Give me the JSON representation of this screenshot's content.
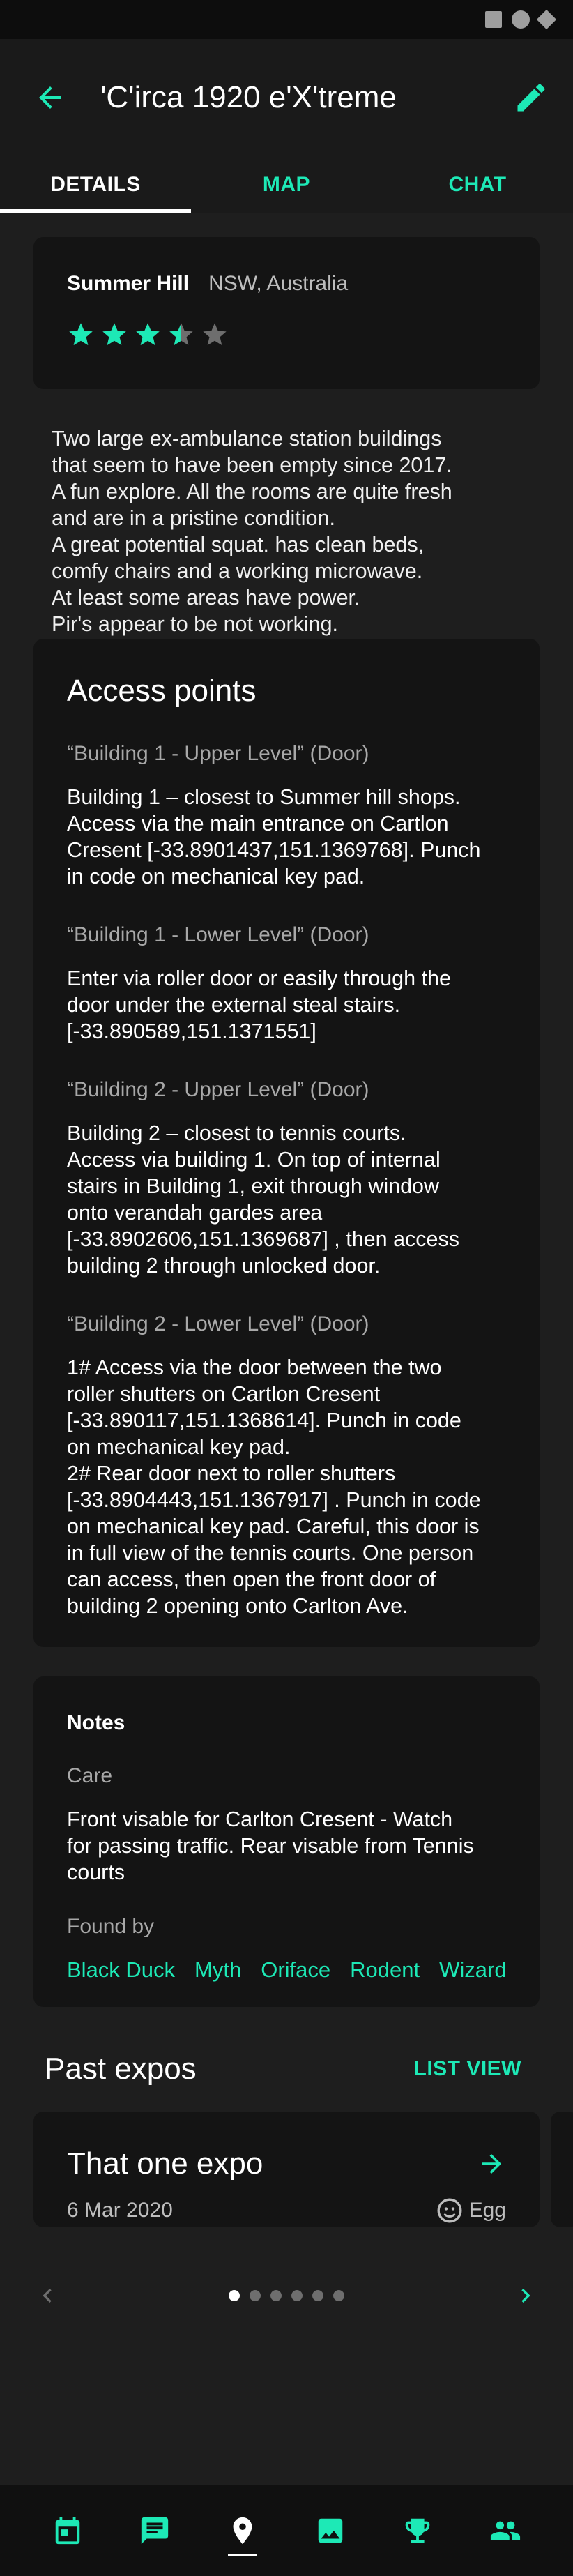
{
  "app": {
    "title": "'C'irca 1920 e'X'treme"
  },
  "tabs": [
    {
      "label": "DETAILS",
      "active": true
    },
    {
      "label": "MAP",
      "active": false
    },
    {
      "label": "CHAT",
      "active": false
    }
  ],
  "location": {
    "name": "Summer Hill",
    "region": "NSW, Australia",
    "rating": 3.5,
    "rating_max": 5
  },
  "description": "Two large ex-ambulance station buildings\nthat seem to have been empty since 2017.\nA fun explore. All the rooms are quite fresh\nand are in a pristine condition.\nA great potential squat. has clean beds,\ncomfy chairs and a working microwave.\nAt least some areas have power.\nPir's appear to be not working.",
  "access": {
    "title": "Access points",
    "points": [
      {
        "name": "“Building 1 - Upper Level” (Door)",
        "description": "Building 1 – closest to Summer hill shops.\nAccess via the main entrance on Cartlon\nCresent [-33.8901437,151.1369768]. Punch\nin code on mechanical key pad."
      },
      {
        "name": "“Building 1 - Lower Level” (Door)",
        "description": "Enter via roller door or easily through the\ndoor under the external steal stairs.\n[-33.890589,151.1371551]"
      },
      {
        "name": "“Building 2 - Upper Level” (Door)",
        "description": "Building 2 – closest to tennis courts.\nAccess via building 1. On top of internal\nstairs in Building 1, exit through window\nonto verandah gardes area\n[-33.8902606,151.1369687] , then access\nbuilding 2 through unlocked door."
      },
      {
        "name": "“Building 2 - Lower Level” (Door)",
        "description": "1# Access via the door between the two\nroller shutters on Cartlon Cresent\n[-33.890117,151.1368614]. Punch in code\non mechanical key pad.\n2# Rear door next to roller shutters\n[-33.8904443,151.1367917] . Punch in code\non mechanical key pad. Careful, this door is\nin full view of the tennis courts. One person\ncan access, then open the front door of\nbuilding 2 opening onto Carlton Ave."
      }
    ]
  },
  "notes": {
    "title": "Notes",
    "care_label": "Care",
    "care_text": "Front visable for Carlton Cresent - Watch\nfor passing traffic. Rear visable from Tennis\ncourts",
    "found_label": "Found by",
    "found_by": [
      "Black Duck",
      "Myth",
      "Oriface",
      "Rodent",
      "Wizard"
    ]
  },
  "expos": {
    "title": "Past expos",
    "list_view_label": "LIST VIEW",
    "items": [
      {
        "name": "That one expo",
        "date": "6 Mar 2020",
        "user": "Egg"
      }
    ],
    "page_count": 6,
    "current_page": 1
  },
  "bottom_nav": [
    {
      "icon": "calendar-icon",
      "active": false
    },
    {
      "icon": "chat-icon",
      "active": false
    },
    {
      "icon": "location-pin-icon",
      "active": true
    },
    {
      "icon": "image-icon",
      "active": false
    },
    {
      "icon": "trophy-icon",
      "active": false
    },
    {
      "icon": "people-icon",
      "active": false
    }
  ],
  "colors": {
    "accent": "#1de9b6",
    "background": "#1e1e1e",
    "card": "#141414",
    "star_inactive": "#6e6e6e"
  }
}
